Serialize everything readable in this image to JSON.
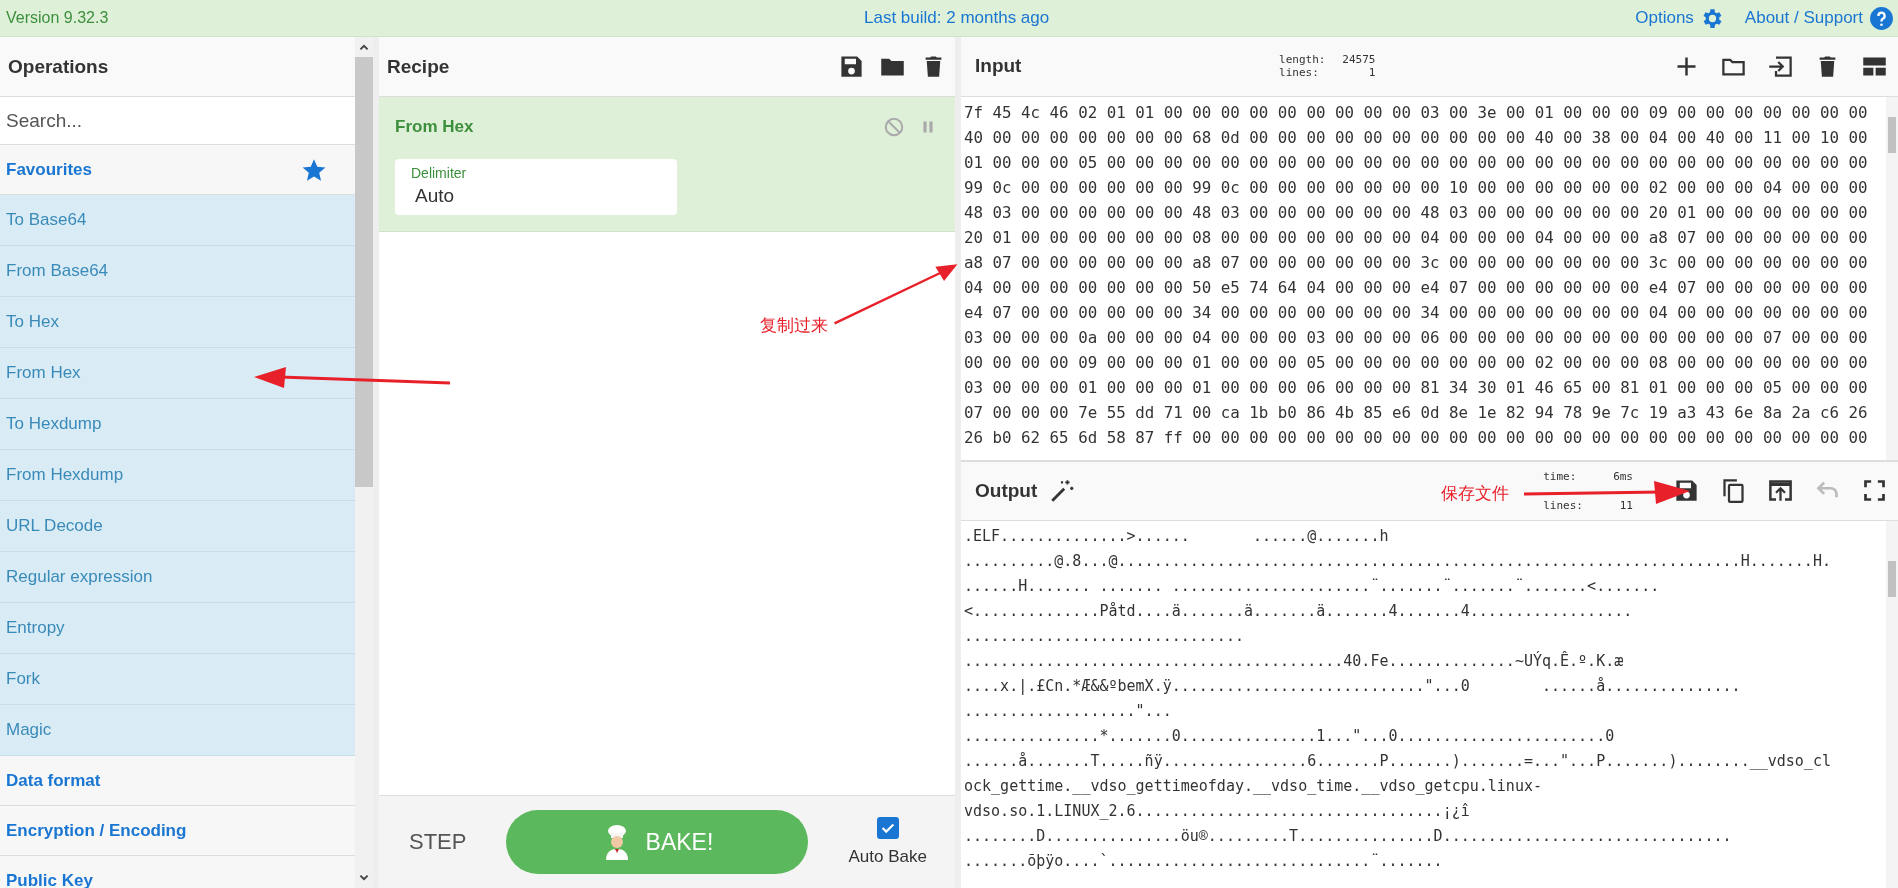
{
  "top_bar": {
    "version": "Version 9.32.3",
    "last_build": "Last build: 2 months ago",
    "options": "Options",
    "about": "About / Support"
  },
  "operations": {
    "title": "Operations",
    "search": {
      "placeholder": "Search..."
    },
    "items": [
      {
        "kind": "category",
        "label": "Favourites"
      },
      {
        "kind": "operation",
        "label": "To Base64"
      },
      {
        "kind": "operation",
        "label": "From Base64"
      },
      {
        "kind": "operation",
        "label": "To Hex"
      },
      {
        "kind": "operation",
        "label": "From Hex"
      },
      {
        "kind": "operation",
        "label": "To Hexdump"
      },
      {
        "kind": "operation",
        "label": "From Hexdump"
      },
      {
        "kind": "operation",
        "label": "URL Decode"
      },
      {
        "kind": "operation",
        "label": "Regular expression"
      },
      {
        "kind": "operation",
        "label": "Entropy"
      },
      {
        "kind": "operation",
        "label": "Fork"
      },
      {
        "kind": "operation",
        "label": "Magic"
      },
      {
        "kind": "category",
        "label": "Data format"
      },
      {
        "kind": "category",
        "label": "Encryption / Encoding"
      },
      {
        "kind": "category",
        "label": "Public Key"
      }
    ]
  },
  "recipe": {
    "title": "Recipe",
    "operation": {
      "name": "From Hex",
      "disabled": false,
      "paused": false,
      "arg_label": "Delimiter",
      "arg_value": "Auto"
    },
    "step": "STEP",
    "bake": "BAKE!",
    "auto_bake": {
      "label": "Auto Bake",
      "checked": true
    }
  },
  "input": {
    "title": "Input",
    "stats": [
      {
        "label": "length:",
        "value": "24575"
      },
      {
        "label": "lines:",
        "value": "1"
      }
    ],
    "lines": [
      "7f 45 4c 46 02 01 01 00 00 00 00 00 00 00 00 00 03 00 3e 00 01 00 00 00 09 00 00 00 00 00 00 00",
      "40 00 00 00 00 00 00 00 68 0d 00 00 00 00 00 00 00 00 00 00 40 00 38 00 04 00 40 00 11 00 10 00",
      "01 00 00 00 05 00 00 00 00 00 00 00 00 00 00 00 00 00 00 00 00 00 00 00 00 00 00 00 00 00 00 00",
      "99 0c 00 00 00 00 00 00 99 0c 00 00 00 00 00 00 00 10 00 00 00 00 00 00 02 00 00 00 04 00 00 00",
      "48 03 00 00 00 00 00 00 48 03 00 00 00 00 00 00 48 03 00 00 00 00 00 00 20 01 00 00 00 00 00 00",
      "20 01 00 00 00 00 00 00 08 00 00 00 00 00 00 00 04 00 00 00 04 00 00 00 a8 07 00 00 00 00 00 00",
      "a8 07 00 00 00 00 00 00 a8 07 00 00 00 00 00 00 3c 00 00 00 00 00 00 00 3c 00 00 00 00 00 00 00",
      "04 00 00 00 00 00 00 00 50 e5 74 64 04 00 00 00 e4 07 00 00 00 00 00 00 e4 07 00 00 00 00 00 00",
      "e4 07 00 00 00 00 00 00 34 00 00 00 00 00 00 00 34 00 00 00 00 00 00 00 04 00 00 00 00 00 00 00",
      "03 00 00 00 0a 00 00 00 04 00 00 00 03 00 00 00 06 00 00 00 00 00 00 00 00 00 00 00 07 00 00 00",
      "00 00 00 00 09 00 00 00 01 00 00 00 05 00 00 00 00 00 00 00 02 00 00 00 08 00 00 00 00 00 00 00",
      "03 00 00 00 01 00 00 00 01 00 00 00 06 00 00 00 81 34 30 01 46 65 00 81 01 00 00 00 05 00 00 00",
      "07 00 00 00 7e 55 dd 71 00 ca 1b b0 86 4b 85 e6 0d 8e 1e 82 94 78 9e 7c 19 a3 43 6e 8a 2a c6 26",
      "26 b0 62 65 6d 58 87 ff 00 00 00 00 00 00 00 00 00 00 00 00 00 00 00 00 00 00 00 00 00 00 00 00"
    ]
  },
  "output": {
    "title": "Output",
    "stats": [
      {
        "label": "time:",
        "value": "6ms"
      },
      {
        "label": "lines:",
        "value": "11"
      }
    ],
    "lines": [
      ".ELF..............>......       ......@.......h",
      "..........@.8...@.....................................................................H.......H.",
      "......H....... ....... ......................¨.......¨.......¨.......<.......",
      "<..............Påtd....ä.......ä.......ä.......4.......4..................",
      "...............................",
      "..........................................40.Fe..............~UÝq.Ê.º.K.æ",
      "....x.|.£Cn.*Æ&&ºbemX.ÿ............................\"...0        ......å...............",
      "...................\"...",
      "...............*.......0...............1...\"...0.......................0",
      "......å.......T.....ñÿ................6.......P.......).......=...\"...P.......)........__vdso_cl",
      "ock_gettime.__vdso_gettimeofday.__vdso_time.__vdso_getcpu.linux-",
      "vdso.so.1.LINUX_2.6..................................¡¿î",
      "........D...............öu®.........T...............D................................",
      ".......õþÿo....`.............................¨......."
    ]
  },
  "annotations": [
    {
      "kind": "labeled_arrow",
      "text": "复制过来"
    },
    {
      "kind": "arrow"
    },
    {
      "kind": "labeled_arrow",
      "text": "保存文件"
    }
  ]
}
